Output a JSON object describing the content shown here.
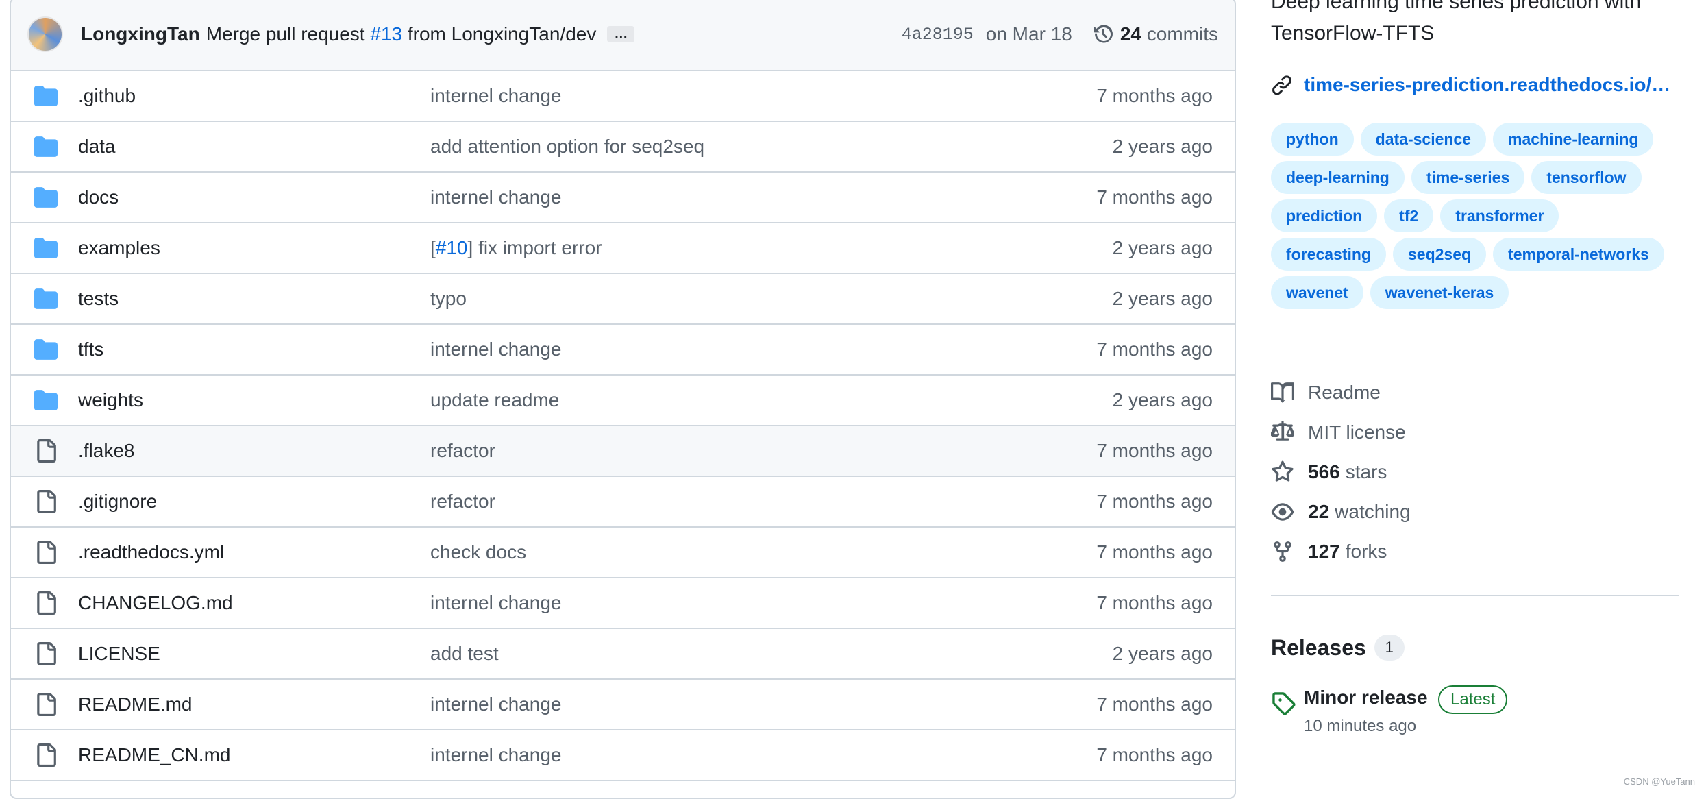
{
  "commit": {
    "author": "LongxingTan",
    "message_prefix": "Merge pull request",
    "pr_link": "#13",
    "message_suffix": "from LongxingTan/dev",
    "ellipsis": "…",
    "sha": "4a28195",
    "date": "on Mar 18",
    "commit_count": "24",
    "commit_label": "commits"
  },
  "files": [
    {
      "type": "folder",
      "name": ".github",
      "message": "internel change",
      "age": "7 months ago"
    },
    {
      "type": "folder",
      "name": "data",
      "message": "add attention option for seq2seq",
      "age": "2 years ago"
    },
    {
      "type": "folder",
      "name": "docs",
      "message": "internel change",
      "age": "7 months ago"
    },
    {
      "type": "folder",
      "name": "examples",
      "message_pre": "[",
      "message_link": "#10",
      "message_post": "] fix import error",
      "age": "2 years ago"
    },
    {
      "type": "folder",
      "name": "tests",
      "message": "typo",
      "age": "2 years ago"
    },
    {
      "type": "folder",
      "name": "tfts",
      "message": "internel change",
      "age": "7 months ago"
    },
    {
      "type": "folder",
      "name": "weights",
      "message": "update readme",
      "age": "2 years ago"
    },
    {
      "type": "file",
      "name": ".flake8",
      "message": "refactor",
      "age": "7 months ago"
    },
    {
      "type": "file",
      "name": ".gitignore",
      "message": "refactor",
      "age": "7 months ago"
    },
    {
      "type": "file",
      "name": ".readthedocs.yml",
      "message": "check docs",
      "age": "7 months ago"
    },
    {
      "type": "file",
      "name": "CHANGELOG.md",
      "message": "internel change",
      "age": "7 months ago"
    },
    {
      "type": "file",
      "name": "LICENSE",
      "message": "add test",
      "age": "2 years ago"
    },
    {
      "type": "file",
      "name": "README.md",
      "message": "internel change",
      "age": "7 months ago"
    },
    {
      "type": "file",
      "name": "README_CN.md",
      "message": "internel change",
      "age": "7 months ago"
    }
  ],
  "sidebar": {
    "about_line1": "Deep learning time series prediction with",
    "about_line2": "TensorFlow-TFTS",
    "website": "time-series-prediction.readthedocs.io/…",
    "topics": [
      "python",
      "data-science",
      "machine-learning",
      "deep-learning",
      "time-series",
      "tensorflow",
      "prediction",
      "tf2",
      "transformer",
      "forecasting",
      "seq2seq",
      "temporal-networks",
      "wavenet",
      "wavenet-keras"
    ],
    "readme": "Readme",
    "license": "MIT license",
    "stars_count": "566",
    "stars_label": "stars",
    "watching_count": "22",
    "watching_label": "watching",
    "forks_count": "127",
    "forks_label": "forks",
    "releases_title": "Releases",
    "releases_count": "1",
    "release_name": "Minor release",
    "release_badge": "Latest",
    "release_time": "10 minutes ago"
  },
  "watermark": "CSDN @YueTann",
  "colors": {
    "link": "#0969da",
    "folder": "#54aeff",
    "latest": "#1a7f37",
    "topic_bg": "#ddf4ff"
  }
}
